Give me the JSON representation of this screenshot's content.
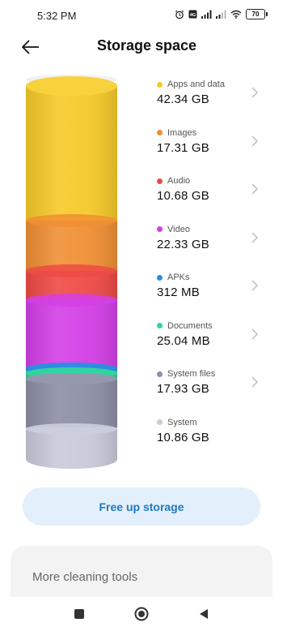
{
  "status_bar": {
    "time": "5:32 PM",
    "battery": "70",
    "icons": [
      "alarm-icon",
      "volte-icon",
      "signal-icon",
      "signal-icon",
      "wifi-icon",
      "battery-icon"
    ]
  },
  "header": {
    "title": "Storage space",
    "back_icon": "back-arrow-icon"
  },
  "storage": {
    "items": [
      {
        "label": "Apps and data",
        "value": "42.34 GB",
        "color": "#f6c928",
        "has_chevron": true
      },
      {
        "label": "Images",
        "value": "17.31 GB",
        "color": "#f08f33",
        "has_chevron": true
      },
      {
        "label": "Audio",
        "value": "10.68 GB",
        "color": "#ef4a45",
        "has_chevron": true
      },
      {
        "label": "Video",
        "value": "22.33 GB",
        "color": "#d33fe6",
        "has_chevron": true
      },
      {
        "label": "APKs",
        "value": "312 MB",
        "color": "#2f8ce0",
        "has_chevron": true
      },
      {
        "label": "Documents",
        "value": "25.04 MB",
        "color": "#33d3a0",
        "has_chevron": true
      },
      {
        "label": "System files",
        "value": "17.93 GB",
        "color": "#8c8fa6",
        "has_chevron": true
      },
      {
        "label": "System",
        "value": "10.86 GB",
        "color": "#c9cad9",
        "has_chevron": false
      }
    ]
  },
  "actions": {
    "free_up": "Free up storage",
    "more_tools": "More cleaning tools"
  },
  "navbar": {
    "icons": [
      "recents-square-icon",
      "home-circle-icon",
      "back-triangle-icon"
    ]
  }
}
